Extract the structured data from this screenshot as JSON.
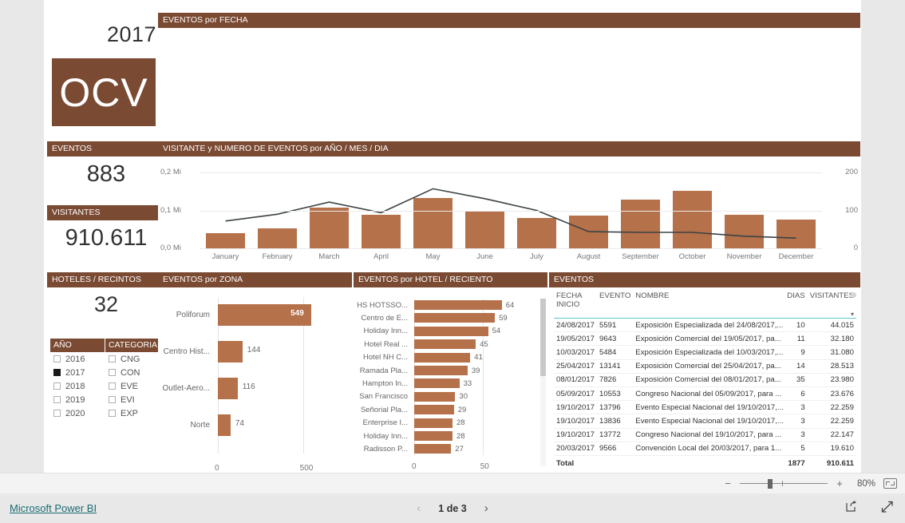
{
  "theme": {
    "header_brown": "#7a4a33",
    "bar_orange": "#b5714a",
    "accent_teal": "#5ec8c8",
    "link_teal": "#1a6b72"
  },
  "logo": {
    "year": "2017",
    "text": "OCV"
  },
  "panels": {
    "fecha": "EVENTOS por FECHA",
    "month": "VISITANTE y NUMERO DE EVENTOS  por  AÑO / MES / DIA",
    "zona": "EVENTOS por ZONA",
    "hotel": "EVENTOS por HOTEL / RECIENTO",
    "tabla": "EVENTOS"
  },
  "kpis": [
    {
      "title": "EVENTOS",
      "value": "883"
    },
    {
      "title": "VISITANTES",
      "value": "910.611"
    },
    {
      "title": "HOTELES / RECINTOS",
      "value": "32"
    }
  ],
  "slicers": [
    {
      "title": "AÑO",
      "items": [
        {
          "label": "2016",
          "checked": false
        },
        {
          "label": "2017",
          "checked": true
        },
        {
          "label": "2018",
          "checked": false
        },
        {
          "label": "2019",
          "checked": false
        },
        {
          "label": "2020",
          "checked": false
        }
      ]
    },
    {
      "title": "CATEGORIA",
      "items": [
        {
          "label": "CNG",
          "checked": false
        },
        {
          "label": "CON",
          "checked": false
        },
        {
          "label": "EVE",
          "checked": false
        },
        {
          "label": "EVI",
          "checked": false
        },
        {
          "label": "EXP",
          "checked": false
        }
      ]
    }
  ],
  "chart_data": [
    {
      "id": "month_combo",
      "type": "bar",
      "title": "VISITANTE y NUMERO DE EVENTOS  por  AÑO / MES / DIA",
      "xlabel": "",
      "ylabel": "VISITANTES",
      "categories": [
        "January",
        "February",
        "March",
        "April",
        "May",
        "June",
        "July",
        "August",
        "September",
        "October",
        "November",
        "December"
      ],
      "series": [
        {
          "name": "VISITANTES",
          "kind": "bar",
          "axis": "left",
          "values": [
            40000,
            52000,
            107000,
            89000,
            133000,
            99000,
            80000,
            87000,
            129000,
            152000,
            88000,
            76000
          ]
        },
        {
          "name": "NUMERO DE EVENTOS",
          "kind": "line",
          "axis": "right",
          "values": [
            72,
            90,
            122,
            94,
            157,
            131,
            100,
            44,
            42,
            42,
            32,
            27
          ]
        }
      ],
      "left_axis": {
        "ticks": [
          "0,0 Mi",
          "0,1 Mi",
          "0,2 Mi"
        ],
        "min": 0,
        "max": 200000
      },
      "right_axis": {
        "ticks": [
          "0",
          "100",
          "200"
        ],
        "min": 0,
        "max": 200
      },
      "grid": true,
      "legend": "none"
    },
    {
      "id": "zona_bar",
      "type": "bar",
      "orientation": "horizontal",
      "title": "EVENTOS por ZONA",
      "categories": [
        "Poliforum",
        "Centro Hist...",
        "Outlet-Aero...",
        "Norte"
      ],
      "values": [
        549,
        144,
        116,
        74
      ],
      "labels": [
        "549",
        "144",
        "116",
        "74"
      ],
      "xlabel": "",
      "ylabel": "",
      "axis_ticks": [
        "0",
        "500"
      ],
      "xlim": [
        0,
        600
      ]
    },
    {
      "id": "hotel_bar",
      "type": "bar",
      "orientation": "horizontal",
      "title": "EVENTOS por HOTEL / RECIENTO",
      "categories": [
        "HS HOTSSO...",
        "Centro de E...",
        "Holiday Inn...",
        "Hotel Real ...",
        "Hotel NH C...",
        "Ramada Pla...",
        "Hampton In...",
        "San Francisco",
        "Señorial Pla...",
        "Enterprise I...",
        "Holiday Inn...",
        "Radisson P..."
      ],
      "values": [
        64,
        59,
        54,
        45,
        41,
        39,
        33,
        30,
        29,
        28,
        28,
        27
      ],
      "labels": [
        "64",
        "59",
        "54",
        "45",
        "41",
        "39",
        "33",
        "30",
        "29",
        "28",
        "28",
        "27"
      ],
      "xlabel": "",
      "ylabel": "",
      "axis_ticks": [
        "0",
        "50"
      ],
      "xlim": [
        0,
        70
      ]
    }
  ],
  "table": {
    "columns": [
      "FECHA INICIO",
      "EVENTO",
      "NOMBRE",
      "DIAS",
      "VISITANTES"
    ],
    "columns_split": [
      [
        "FECHA",
        "INICIO"
      ],
      [
        "EVENTO"
      ],
      [
        "NOMBRE"
      ],
      [
        "DIAS"
      ],
      [
        "VISITANTES"
      ]
    ],
    "sorted_by": "VISITANTES",
    "sort_direction": "desc",
    "rows": [
      [
        "24/08/2017",
        "5591",
        "Exposición Especializada del 24/08/2017,...",
        "10",
        "44.015"
      ],
      [
        "19/05/2017",
        "9643",
        "Exposición Comercial del 19/05/2017, pa...",
        "11",
        "32.180"
      ],
      [
        "10/03/2017",
        "5484",
        "Exposición Especializada del 10/03/2017,...",
        "9",
        "31.080"
      ],
      [
        "25/04/2017",
        "13141",
        "Exposición Comercial del 25/04/2017, pa...",
        "14",
        "28.513"
      ],
      [
        "08/01/2017",
        "7826",
        "Exposición Comercial del 08/01/2017, pa...",
        "35",
        "23.980"
      ],
      [
        "05/09/2017",
        "10553",
        "Congreso Nacional del 05/09/2017, para ...",
        "6",
        "23.676"
      ],
      [
        "19/10/2017",
        "13796",
        "Evento Especial Nacional del 19/10/2017,...",
        "3",
        "22.259"
      ],
      [
        "19/10/2017",
        "13836",
        "Evento Especial Nacional del 19/10/2017,...",
        "3",
        "22.259"
      ],
      [
        "19/10/2017",
        "13772",
        "Congreso Nacional del 19/10/2017, para ...",
        "3",
        "22.147"
      ],
      [
        "20/03/2017",
        "9566",
        "Convención Local del 20/03/2017, para 1...",
        "5",
        "19.610"
      ]
    ],
    "total_row": [
      "Total",
      "",
      "",
      "1877",
      "910.611"
    ]
  },
  "zoombar": {
    "minus": "−",
    "plus": "+",
    "percent": "80%",
    "fit_icon": "fit-to-page-icon"
  },
  "statusbar": {
    "brand": "Microsoft Power BI",
    "page_text": "1 de 3",
    "prev_icon": "chevron-left-icon",
    "next_icon": "chevron-right-icon",
    "share_icon": "share-icon",
    "fullscreen_icon": "fullscreen-icon"
  }
}
